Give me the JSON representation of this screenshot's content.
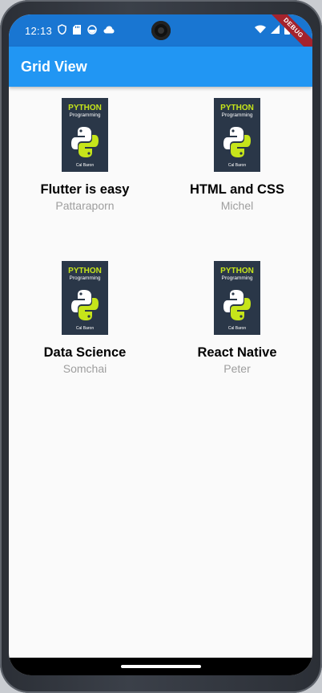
{
  "status_bar": {
    "time": "12:13",
    "left_icons": [
      "shield-icon",
      "sd-card-icon",
      "circle-status-icon",
      "cloud-icon"
    ],
    "right_icons": [
      "wifi-icon",
      "signal-icon",
      "battery-icon"
    ],
    "debug_banner": "DEBUG"
  },
  "app_bar": {
    "title": "Grid View",
    "color": "#2196f3"
  },
  "books": [
    {
      "title": "Flutter is easy",
      "author": "Pattaraporn",
      "cover": {
        "line1": "PYTHON",
        "line2": "Programming",
        "line3": "Cal Baron"
      }
    },
    {
      "title": "HTML and CSS",
      "author": "Michel",
      "cover": {
        "line1": "PYTHON",
        "line2": "Programming",
        "line3": "Cal Baron"
      }
    },
    {
      "title": "Data Science",
      "author": "Somchai",
      "cover": {
        "line1": "PYTHON",
        "line2": "Programming",
        "line3": "Cal Baron"
      }
    },
    {
      "title": "React Native",
      "author": "Peter",
      "cover": {
        "line1": "PYTHON",
        "line2": "Programming",
        "line3": "Cal Baron"
      }
    }
  ]
}
